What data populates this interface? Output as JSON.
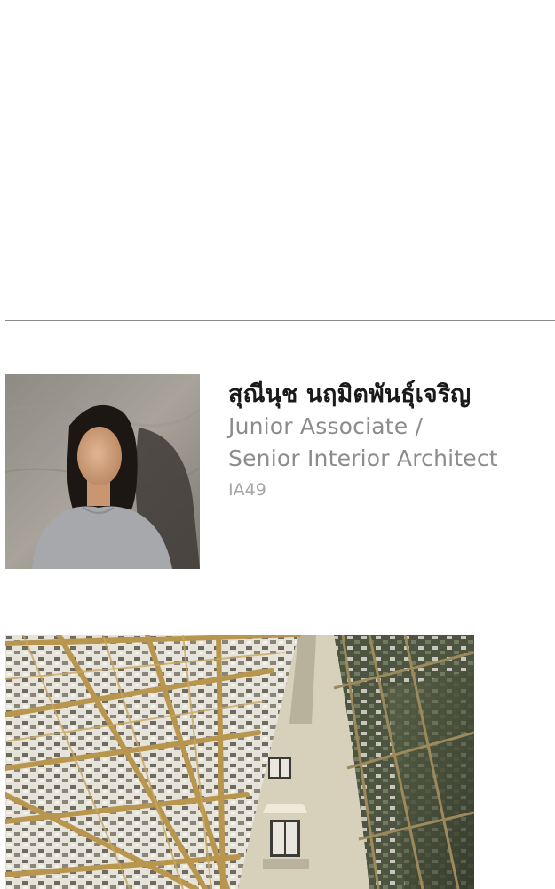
{
  "profile": {
    "name": "สุณีนุช นฤมิตพันธุ์เจริญ",
    "role_line1": "Junior Associate /",
    "role_line2": "Senior Interior Architect",
    "code": "IA49"
  },
  "colors": {
    "name_text": "#1a1a1a",
    "role_text": "#8c8c8c",
    "code_text": "#a6a6a6",
    "divider": "#8a8a8a"
  }
}
